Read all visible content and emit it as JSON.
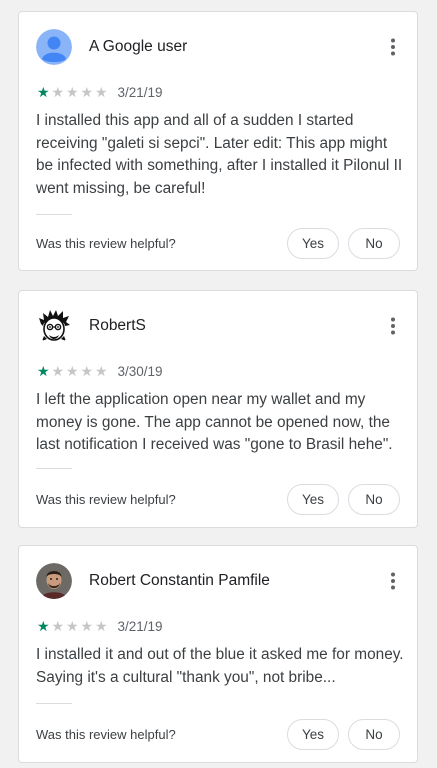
{
  "colors": {
    "star_filled": "#01875f",
    "star_empty": "#c6c6c6",
    "default_avatar": "#4285f4"
  },
  "reviews": [
    {
      "author": "A Google user",
      "avatar_icon": "default-person-avatar",
      "rating": 1,
      "rating_max": 5,
      "date": "3/21/19",
      "text": "I installed this app and all of a sudden I started receiving \"galeti si sepci\". Later edit: This app might be infected with something, after I installed it Pilonul II went missing, be careful!",
      "helpful_question": "Was this review helpful?",
      "yes_label": "Yes",
      "no_label": "No"
    },
    {
      "author": "RobertS",
      "avatar_icon": "cartoon-face-avatar",
      "rating": 1,
      "rating_max": 5,
      "date": "3/30/19",
      "text": "I left the application open near my wallet and my money is gone. The app cannot be opened now, the last notification I received was \"gone to Brasil hehe\".",
      "helpful_question": "Was this review helpful?",
      "yes_label": "Yes",
      "no_label": "No"
    },
    {
      "author": "Robert Constantin Pamfile",
      "avatar_icon": "user-photo-avatar",
      "rating": 1,
      "rating_max": 5,
      "date": "3/21/19",
      "text": "I installed it and out of the blue it asked me for money. Saying it's a cultural \"thank you\", not bribe...",
      "helpful_question": "Was this review helpful?",
      "yes_label": "Yes",
      "no_label": "No"
    }
  ]
}
